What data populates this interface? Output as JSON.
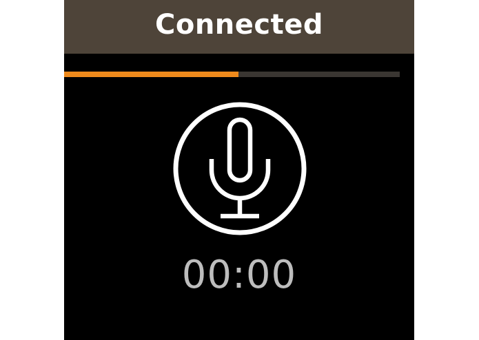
{
  "header": {
    "status": "Connected"
  },
  "progress": {
    "fraction": 0.52,
    "fill_color": "#ef8a1c",
    "track_color": "#3a3632"
  },
  "record": {
    "icon": "microphone-icon"
  },
  "timer": {
    "elapsed": "00:00"
  },
  "colors": {
    "header_bg": "#4e4439",
    "screen_bg": "#000000",
    "timer_text": "#bdbdbd"
  }
}
